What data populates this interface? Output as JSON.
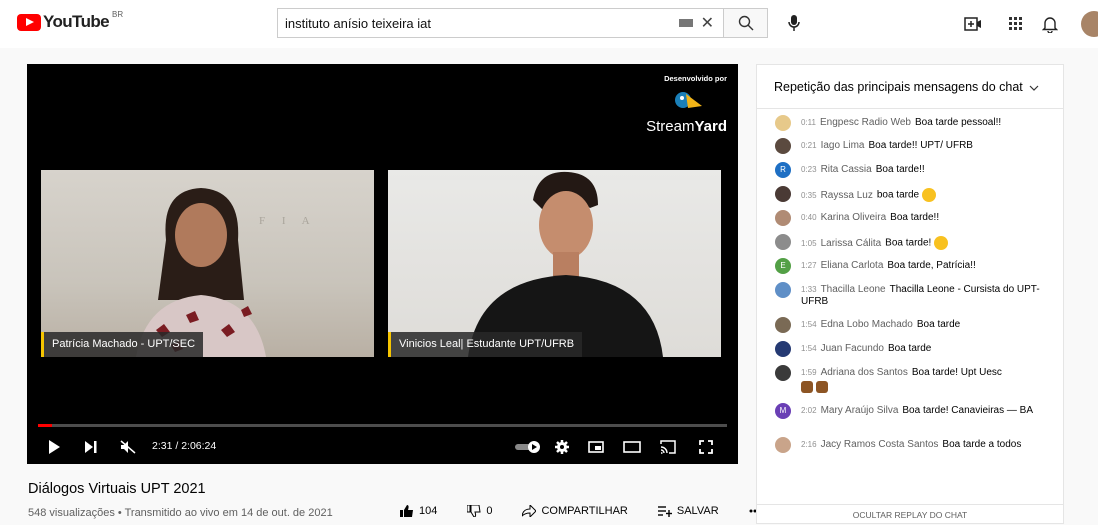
{
  "header": {
    "logo_text": "YouTube",
    "region": "BR",
    "search_value": "instituto anísio teixeira iat"
  },
  "player": {
    "streamyard_credit": "Desenvolvido por",
    "streamyard_brand_a": "Stream",
    "streamyard_brand_b": "Yard",
    "left_wall_text": "F I A",
    "left_name": "Patrícia Machado - UPT/SEC",
    "right_name": "Vinicios Leal| Estudante UPT/UFRB",
    "time": "2:31 / 2:06:24",
    "progress": 0.02
  },
  "video": {
    "title": "Diálogos Virtuais UPT 2021",
    "meta": "548 visualizações • Transmitido ao vivo em 14 de out. de 2021",
    "likes": "104",
    "dislikes": "0",
    "share": "COMPARTILHAR",
    "save": "SALVAR"
  },
  "chat": {
    "header": "Repetição das principais mensagens do chat",
    "footer": "OCULTAR REPLAY DO CHAT",
    "messages": [
      {
        "t": "0:11",
        "author": "Engpesc Radio Web",
        "text": "Boa tarde pessoal!!",
        "color": "#e7c98a"
      },
      {
        "t": "0:21",
        "author": "Iago Lima",
        "text": "Boa tarde!! UPT/ UFRB",
        "color": "#5b4a3f"
      },
      {
        "t": "0:23",
        "author": "Rita Cassia",
        "text": "Boa tarde!!",
        "color": "#1e6fc4",
        "initial": "R"
      },
      {
        "t": "0:35",
        "author": "Rayssa Luz",
        "text": "boa tarde",
        "color": "#4a3a35"
      },
      {
        "t": "0:40",
        "author": "Karina Oliveira",
        "text": "Boa tarde!!",
        "color": "#b08b74"
      },
      {
        "t": "1:05",
        "author": "Larissa Cálita",
        "text": "Boa tarde!",
        "color": "#8c8c8c"
      },
      {
        "t": "1:27",
        "author": "Eliana Carlota",
        "text": "Boa tarde, Patrícia!!",
        "color": "#53a046",
        "initial": "E"
      },
      {
        "t": "1:33",
        "author": "Thacilla Leone",
        "text": "Thacilla Leone - Cursista do UPT-UFRB",
        "color": "#5f8fc7"
      },
      {
        "t": "1:54",
        "author": "Edna Lobo Machado",
        "text": "Boa tarde",
        "color": "#7a6a55"
      },
      {
        "t": "1:54",
        "author": "Juan Facundo",
        "text": "Boa tarde",
        "color": "#253a73"
      },
      {
        "t": "1:59",
        "author": "Adriana dos Santos",
        "text": "Boa tarde! Upt Uesc",
        "color": "#3a3a3a"
      },
      {
        "t": "2:02",
        "author": "Mary Araújo Silva",
        "text": "Boa tarde! Canavieiras — BA",
        "color": "#6a3fb5",
        "initial": "M"
      },
      {
        "t": "2:16",
        "author": "Jacy Ramos Costa Santos",
        "text": "Boa tarde a todos",
        "color": "#c9a48a"
      }
    ]
  }
}
